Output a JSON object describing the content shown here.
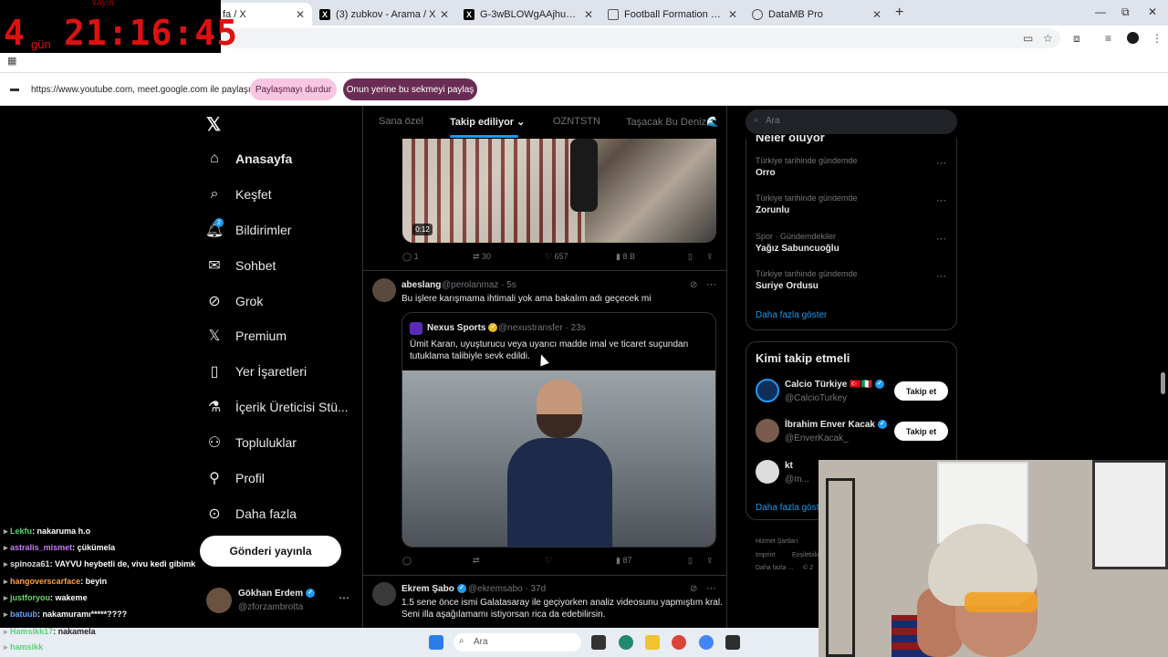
{
  "browser": {
    "tabs": [
      {
        "label": "fa / X",
        "active": true
      },
      {
        "label": "(3) zubkov - Arama / X",
        "active": false
      },
      {
        "label": "G-3wBLOWgAAjhu4 (597×680)",
        "active": false
      },
      {
        "label": "Football Formation Creator: Re",
        "active": false
      },
      {
        "label": "DataMB Pro",
        "active": false
      }
    ],
    "share_bar": {
      "text": "https://www.youtube.com, meet.google.com ile paylaşılıyor",
      "stop_label": "Paylaşmayı durdur",
      "switch_label": "Onun yerine bu sekmeyi paylaş"
    }
  },
  "timer": {
    "label": "Yayın",
    "days": "4",
    "days_unit": "gün",
    "clock": "21:16:45"
  },
  "nav": {
    "items": [
      {
        "label": "Anasayfa",
        "icon": "home-icon"
      },
      {
        "label": "Keşfet",
        "icon": "search-icon"
      },
      {
        "label": "Bildirimler",
        "icon": "bell-icon",
        "badge": "2"
      },
      {
        "label": "Sohbet",
        "icon": "mail-icon"
      },
      {
        "label": "Grok",
        "icon": "grok-icon"
      },
      {
        "label": "Premium",
        "icon": "x-icon"
      },
      {
        "label": "Yer İşaretleri",
        "icon": "bookmark-icon"
      },
      {
        "label": "İçerik Üreticisi Stü...",
        "icon": "flask-icon"
      },
      {
        "label": "Topluluklar",
        "icon": "people-icon"
      },
      {
        "label": "Profil",
        "icon": "person-icon"
      },
      {
        "label": "Daha fazla",
        "icon": "more-circle-icon"
      }
    ],
    "post_button": "Gönderi yayınla",
    "account": {
      "name": "Gökhan Erdem",
      "handle": "@zforzambrotta"
    }
  },
  "feed": {
    "tabs": [
      "Sana özel",
      "Takip ediliyor",
      "OZNTSTN",
      "Taşacak Bu Deniz🌊"
    ],
    "active_tab": "Takip ediliyor",
    "post1": {
      "video_time": "0:12",
      "replies": "1",
      "reposts": "30",
      "likes": "657",
      "views": "8 B"
    },
    "post2": {
      "name": "abeslang",
      "handle": "@perolanmaz",
      "time": "· 5s",
      "text": "Bu işlere karışmama ihtimali yok ama bakalım adı geçecek mi",
      "quote": {
        "name": "Nexus Sports",
        "handle": "@nexustransfer",
        "time": "· 23s",
        "text1": "Ümit Karan, uyuşturucu veya uyarıcı madde imal ve ticaret suçundan",
        "text2": "tutuklama talibiyle sevk edildi."
      },
      "views": "87"
    },
    "post3": {
      "name": "Ekrem Şabo",
      "handle": "@ekremsabo",
      "time": "· 37d",
      "text1": "1.5 sene önce ismi Galatasaray ile geçiyorken analiz videosunu yapmıştım kral.",
      "text2": "Seni illa aşağılamamı istiyorsan rica da edebilirsin."
    }
  },
  "right": {
    "search_placeholder": "Ara",
    "trends_title": "Neler oluyor",
    "trends": [
      {
        "meta": "Türkiye tarihinde gündemde",
        "name": "Orro"
      },
      {
        "meta": "Türkiye tarihinde gündemde",
        "name": "Zorunlu"
      },
      {
        "meta": "Spor · Gündemdekiler",
        "name": "Yağız Sabuncuoğlu"
      },
      {
        "meta": "Türkiye tarihinde gündemde",
        "name": "Suriye Ordusu"
      }
    ],
    "show_more": "Daha fazla göster",
    "who_to_follow": "Kimi takip etmeli",
    "follow": [
      {
        "name": "Calcio Türkiye 🇹🇷🇮🇹",
        "handle": "@CalcioTurkey",
        "btn": "Takip et"
      },
      {
        "name": "İbrahim Enver Kacak",
        "handle": "@EnverKacak_",
        "btn": "Takip et"
      },
      {
        "name": "kt",
        "handle": "@m...",
        "btn": ""
      }
    ],
    "show_more2": "Daha fazla göst",
    "footer": [
      "Hizmet Şartları",
      "Imprint",
      "Erişilebilirlik",
      "Daha fazla ...",
      "© 2"
    ]
  },
  "chat": [
    {
      "user": "Lekfu",
      "color": "#5ad17a",
      "msg": ": nakaruma h.o"
    },
    {
      "user": "astralis_mismet",
      "color": "#c77dff",
      "msg": ": çükümela"
    },
    {
      "user": "spinoza61",
      "color": "#e0e0e0",
      "msg": ": VAYVU heybetli de, vivu kedi gibimk"
    },
    {
      "user": "hangoverscarface",
      "color": "#ff9f40",
      "msg": ": beyin"
    },
    {
      "user": "justforyou",
      "color": "#6bd96b",
      "msg": ": wakeme"
    },
    {
      "user": "batuub",
      "color": "#6aa6ff",
      "msg": ": nakamuramı*****????"
    },
    {
      "user": "Hamsikk17",
      "color": "#5ad17a",
      "msg": ": nakamela"
    },
    {
      "user": "hamsikk",
      "color": "#5ad17a",
      "msg": ""
    }
  ],
  "taskbar": {
    "search": "Ara"
  }
}
